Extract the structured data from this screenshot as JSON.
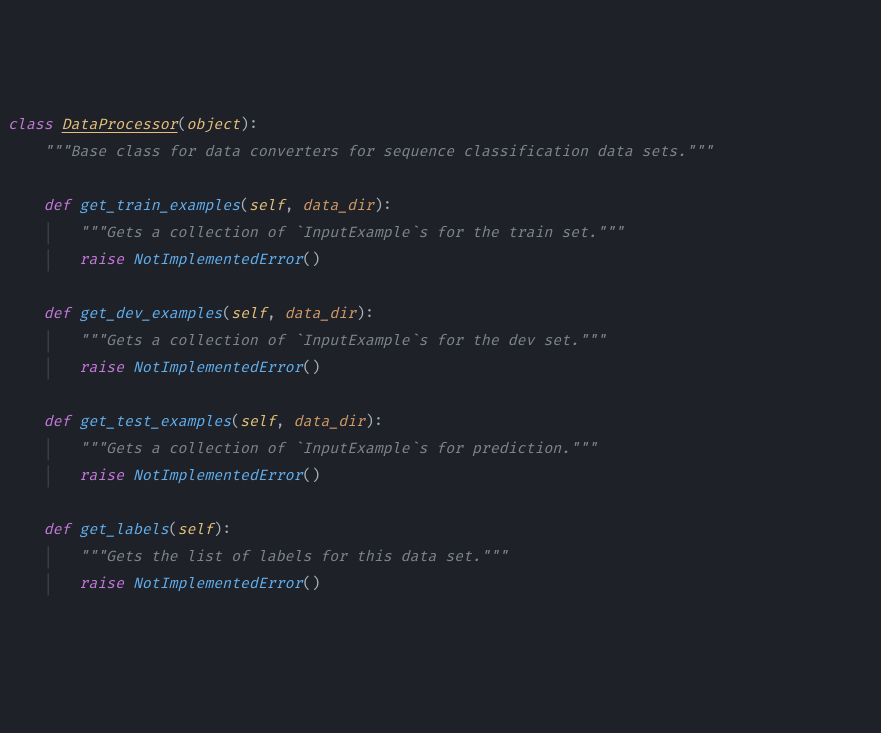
{
  "cls": {
    "kw": "class",
    "name": "DataProcessor",
    "base": "object",
    "doc": "\"\"\"Base class for data converters for sequence classification data sets.\"\"\""
  },
  "methods": [
    {
      "kw": "def",
      "name": "get_train_examples",
      "self": "self",
      "param": "data_dir",
      "doc": "\"\"\"Gets a collection of `InputExample`s for the train set.\"\"\"",
      "raise_kw": "raise",
      "exc": "NotImplementedError"
    },
    {
      "kw": "def",
      "name": "get_dev_examples",
      "self": "self",
      "param": "data_dir",
      "doc": "\"\"\"Gets a collection of `InputExample`s for the dev set.\"\"\"",
      "raise_kw": "raise",
      "exc": "NotImplementedError"
    },
    {
      "kw": "def",
      "name": "get_test_examples",
      "self": "self",
      "param": "data_dir",
      "doc": "\"\"\"Gets a collection of `InputExample`s for prediction.\"\"\"",
      "raise_kw": "raise",
      "exc": "NotImplementedError"
    },
    {
      "kw": "def",
      "name": "get_labels",
      "self": "self",
      "param": null,
      "doc": "\"\"\"Gets the list of labels for this data set.\"\"\"",
      "raise_kw": "raise",
      "exc": "NotImplementedError"
    }
  ],
  "punct": {
    "lp": "(",
    "rp": ")",
    "colon": ":",
    "comma": ", ",
    "call": "()"
  },
  "indent": {
    "l1": "    ",
    "guide2": "    │   "
  }
}
